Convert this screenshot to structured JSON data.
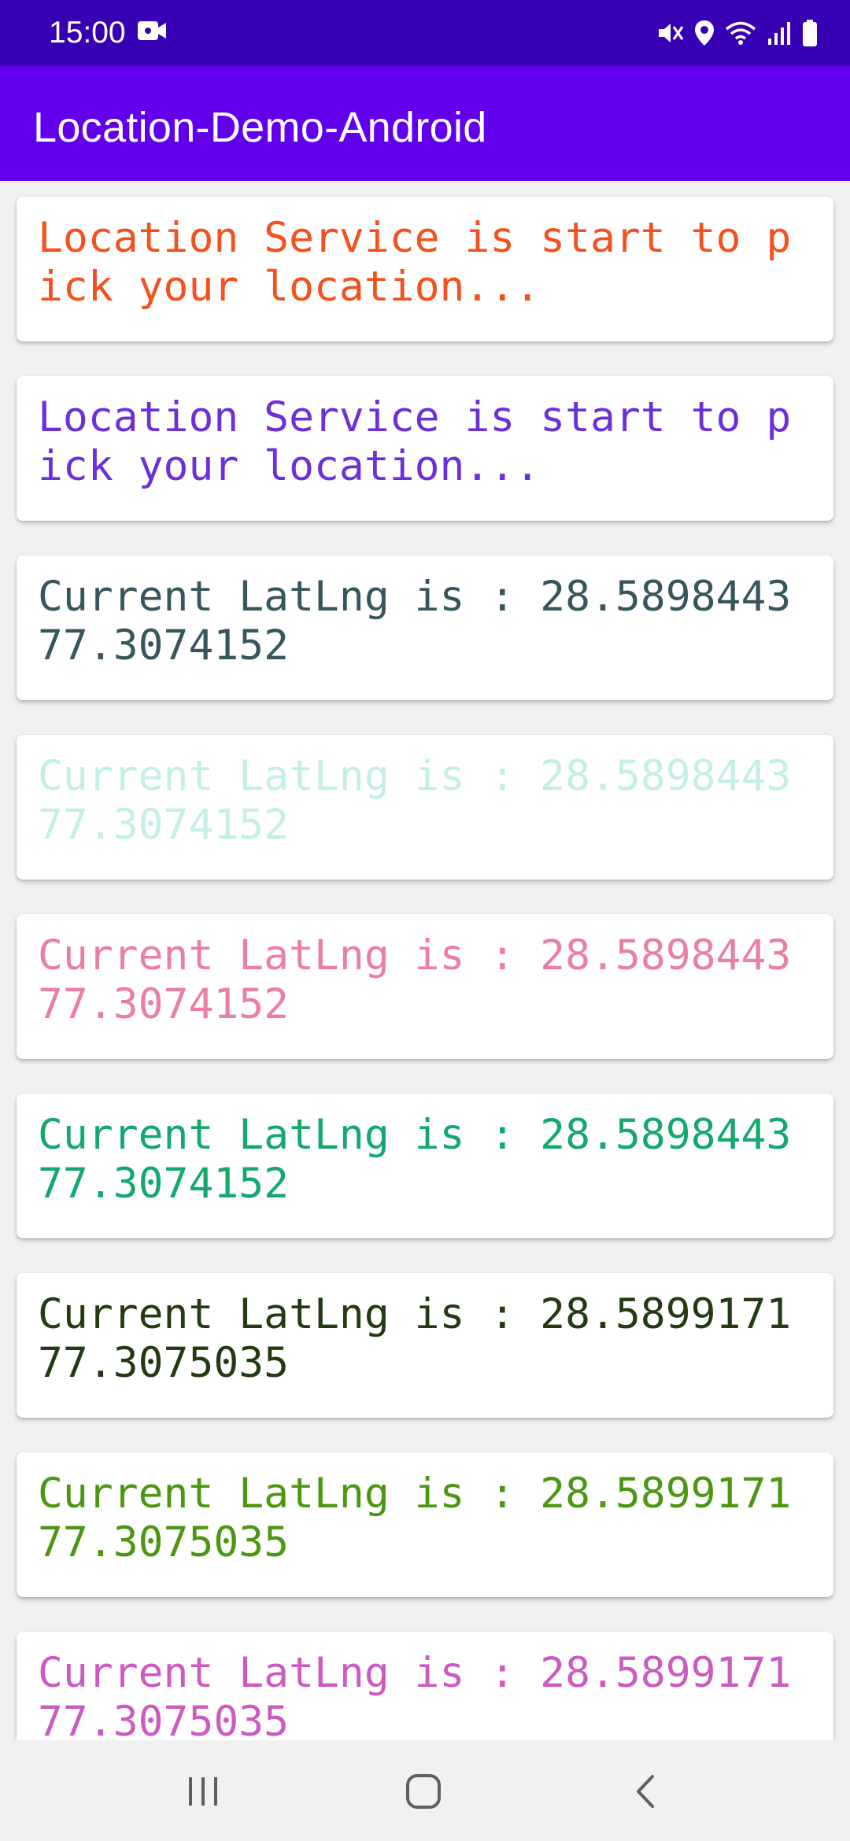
{
  "status_bar": {
    "time": "15:00",
    "left_icon": "video-camera-icon",
    "right_icons": [
      "mute-icon",
      "location-pin-icon",
      "wifi-icon",
      "signal-icon",
      "battery-icon"
    ],
    "background": "#3700b3"
  },
  "app_bar": {
    "title": "Location-Demo-Android",
    "background": "#6200ee"
  },
  "log_items": [
    {
      "text": "Location Service is start to pick your location...",
      "color": "#f4511e"
    },
    {
      "text": "Location Service is start to pick your location...",
      "color": "#6d2fd9"
    },
    {
      "text": "Current LatLng is : 28.5898443 77.3074152",
      "color": "#37565c"
    },
    {
      "text": "Current LatLng is : 28.5898443 77.3074152",
      "color": "#c3efe6"
    },
    {
      "text": "Current LatLng is : 28.5898443 77.3074152",
      "color": "#ea7fa3"
    },
    {
      "text": "Current LatLng is : 28.5898443 77.3074152",
      "color": "#14a86c"
    },
    {
      "text": "Current LatLng is : 28.5899171 77.3075035",
      "color": "#233a13"
    },
    {
      "text": "Current LatLng is : 28.5899171 77.3075035",
      "color": "#4c9612"
    },
    {
      "text": "Current LatLng is : 28.5899171 77.3075035",
      "color": "#cc5ac0"
    }
  ],
  "nav_bar": {
    "buttons": [
      "recent-apps-icon",
      "home-icon",
      "back-icon"
    ]
  }
}
